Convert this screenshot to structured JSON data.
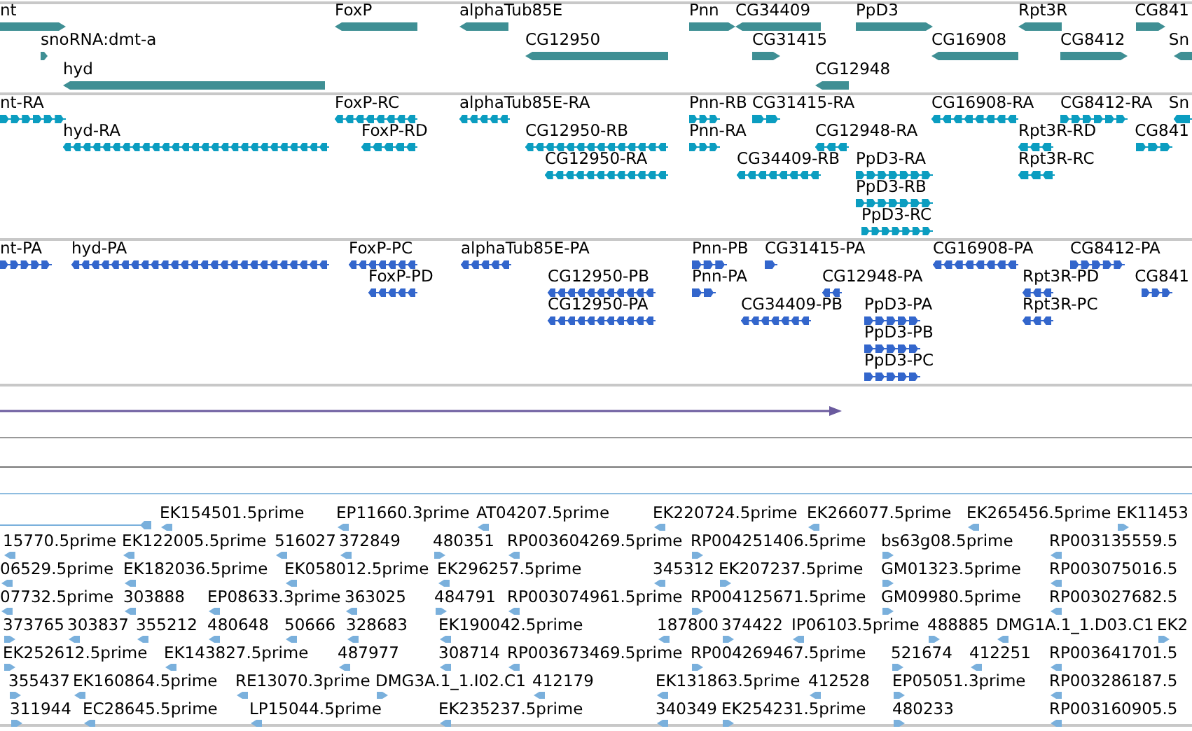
{
  "tracks": [
    {
      "kind": "gene",
      "features": [
        {
          "label": "nt",
          "forward": true
        },
        {
          "label": "snoRNA:dmt-a",
          "forward": true
        },
        {
          "label": "hyd",
          "forward": false
        },
        {
          "label": "FoxP",
          "forward": false
        },
        {
          "label": "alphaTub85E",
          "forward": false
        },
        {
          "label": "CG12950",
          "forward": false
        },
        {
          "label": "Pnn",
          "forward": true
        },
        {
          "label": "CG34409",
          "forward": false
        },
        {
          "label": "CG31415",
          "forward": true
        },
        {
          "label": "CG12948",
          "forward": false
        },
        {
          "label": "PpD3",
          "forward": true
        },
        {
          "label": "CG16908",
          "forward": false
        },
        {
          "label": "Rpt3R",
          "forward": false
        },
        {
          "label": "CG8412",
          "forward": true
        },
        {
          "label": "CG841",
          "forward": true
        },
        {
          "label": "Sn",
          "forward": false
        }
      ]
    },
    {
      "kind": "transcript",
      "features": [
        {
          "label": "nt-RA",
          "forward": true
        },
        {
          "label": "hyd-RA",
          "forward": false
        },
        {
          "label": "FoxP-RC",
          "forward": false
        },
        {
          "label": "FoxP-RD",
          "forward": false
        },
        {
          "label": "alphaTub85E-RA",
          "forward": false
        },
        {
          "label": "CG12950-RB",
          "forward": false
        },
        {
          "label": "CG12950-RA",
          "forward": false
        },
        {
          "label": "Pnn-RB",
          "forward": true
        },
        {
          "label": "CG31415-RA",
          "forward": true
        },
        {
          "label": "Pnn-RA",
          "forward": true
        },
        {
          "label": "CG12948-RA",
          "forward": false
        },
        {
          "label": "CG34409-RB",
          "forward": false
        },
        {
          "label": "PpD3-RA",
          "forward": true
        },
        {
          "label": "PpD3-RB",
          "forward": true
        },
        {
          "label": "PpD3-RC",
          "forward": true
        },
        {
          "label": "CG16908-RA",
          "forward": false
        },
        {
          "label": "CG8412-RA",
          "forward": true
        },
        {
          "label": "Rpt3R-RD",
          "forward": false
        },
        {
          "label": "Rpt3R-RC",
          "forward": false
        },
        {
          "label": "Sn",
          "forward": false
        },
        {
          "label": "CG841",
          "forward": true
        }
      ]
    },
    {
      "kind": "protein",
      "features": [
        {
          "label": "nt-PA",
          "forward": true
        },
        {
          "label": "hyd-PA",
          "forward": false
        },
        {
          "label": "FoxP-PC",
          "forward": false
        },
        {
          "label": "FoxP-PD",
          "forward": false
        },
        {
          "label": "alphaTub85E-PA",
          "forward": false
        },
        {
          "label": "CG12950-PB",
          "forward": false
        },
        {
          "label": "CG12950-PA",
          "forward": false
        },
        {
          "label": "Pnn-PB",
          "forward": true
        },
        {
          "label": "CG31415-PA",
          "forward": true
        },
        {
          "label": "Pnn-PA",
          "forward": true
        },
        {
          "label": "CG12948-PA",
          "forward": false
        },
        {
          "label": "CG34409-PB",
          "forward": false
        },
        {
          "label": "PpD3-PA",
          "forward": true
        },
        {
          "label": "PpD3-PB",
          "forward": true
        },
        {
          "label": "PpD3-PC",
          "forward": true
        },
        {
          "label": "CG16908-PA",
          "forward": false
        },
        {
          "label": "CG8412-PA",
          "forward": true
        },
        {
          "label": "Rpt3R-PD",
          "forward": false
        },
        {
          "label": "Rpt3R-PC",
          "forward": false
        },
        {
          "label": "CG841",
          "forward": true
        }
      ]
    },
    {
      "kind": "alignment",
      "features": [
        {
          "forward": true
        }
      ]
    },
    {
      "kind": "est",
      "features": [
        {
          "label": "EK154501.5prime",
          "forward": false
        },
        {
          "label": "EP11660.3prime",
          "forward": false
        },
        {
          "label": "AT04207.5prime",
          "forward": false
        },
        {
          "label": "EK220724.5prime",
          "forward": false
        },
        {
          "label": "EK266077.5prime",
          "forward": false
        },
        {
          "label": "EK265456.5prime",
          "forward": false
        },
        {
          "label": "EK11453",
          "forward": true
        },
        {
          "label": "15770.5prime",
          "forward": false
        },
        {
          "label": "EK122005.5prime",
          "forward": false
        },
        {
          "label": "516027",
          "forward": false
        },
        {
          "label": "372849",
          "forward": false
        },
        {
          "label": "480351",
          "forward": true
        },
        {
          "label": "RP003604269.5prime",
          "forward": false
        },
        {
          "label": "RP004251406.5prime",
          "forward": true
        },
        {
          "label": "bs63g08.5prime",
          "forward": true
        },
        {
          "label": "RP003135559.5",
          "forward": false
        },
        {
          "label": "06529.5prime",
          "forward": false
        },
        {
          "label": "EK182036.5prime",
          "forward": false
        },
        {
          "label": "EK058012.5prime",
          "forward": false
        },
        {
          "label": "EK296257.5prime",
          "forward": false
        },
        {
          "label": "345312",
          "forward": false
        },
        {
          "label": "EK207237.5prime",
          "forward": true
        },
        {
          "label": "GM01323.5prime",
          "forward": true
        },
        {
          "label": "RP003075016.5",
          "forward": false
        },
        {
          "label": "07732.5prime",
          "forward": false
        },
        {
          "label": "303888",
          "forward": false
        },
        {
          "label": "EP08633.3prime",
          "forward": false
        },
        {
          "label": "363025",
          "forward": false
        },
        {
          "label": "484791",
          "forward": true
        },
        {
          "label": "RP003074961.5prime",
          "forward": false
        },
        {
          "label": "RP004125671.5prime",
          "forward": true
        },
        {
          "label": "GM09980.5prime",
          "forward": true
        },
        {
          "label": "RP003027682.5",
          "forward": false
        },
        {
          "label": "373765",
          "forward": true
        },
        {
          "label": "303837",
          "forward": false
        },
        {
          "label": "355212",
          "forward": false
        },
        {
          "label": "480648",
          "forward": false
        },
        {
          "label": "50666",
          "forward": false
        },
        {
          "label": "328683",
          "forward": false
        },
        {
          "label": "EK190042.5prime",
          "forward": false
        },
        {
          "label": "187800",
          "forward": false
        },
        {
          "label": "374422",
          "forward": true
        },
        {
          "label": "IP06103.5prime",
          "forward": false
        },
        {
          "label": "488885",
          "forward": true
        },
        {
          "label": "DMG1A.1_1.D03.C1",
          "forward": false
        },
        {
          "label": "EK2",
          "forward": true
        },
        {
          "label": "EK252612.5prime",
          "forward": true
        },
        {
          "label": "EK143827.5prime",
          "forward": false
        },
        {
          "label": "487977",
          "forward": false
        },
        {
          "label": "308714",
          "forward": false
        },
        {
          "label": "RP003673469.5prime",
          "forward": false
        },
        {
          "label": "RP004269467.5prime",
          "forward": true
        },
        {
          "label": "521674",
          "forward": true
        },
        {
          "label": "412251",
          "forward": false
        },
        {
          "label": "RP003641701.5",
          "forward": false
        },
        {
          "label": "355437",
          "forward": true
        },
        {
          "label": "EK160864.5prime",
          "forward": false
        },
        {
          "label": "RE13070.3prime",
          "forward": false
        },
        {
          "label": "DMG3A.1_1.I02.C1",
          "forward": true
        },
        {
          "label": "412179",
          "forward": false
        },
        {
          "label": "EK131863.5prime",
          "forward": false
        },
        {
          "label": "412528",
          "forward": false
        },
        {
          "label": "EP05051.3prime",
          "forward": true
        },
        {
          "label": "RP003286187.5",
          "forward": false
        },
        {
          "label": "311944",
          "forward": true
        },
        {
          "label": "EC28645.5prime",
          "forward": false
        },
        {
          "label": "LP15044.5prime",
          "forward": false
        },
        {
          "label": "EK235237.5prime",
          "forward": false
        },
        {
          "label": "340349",
          "forward": false
        },
        {
          "label": "EK254231.5prime",
          "forward": true
        },
        {
          "label": "480233",
          "forward": true
        },
        {
          "label": "RP003160905.5",
          "forward": false
        }
      ]
    }
  ]
}
